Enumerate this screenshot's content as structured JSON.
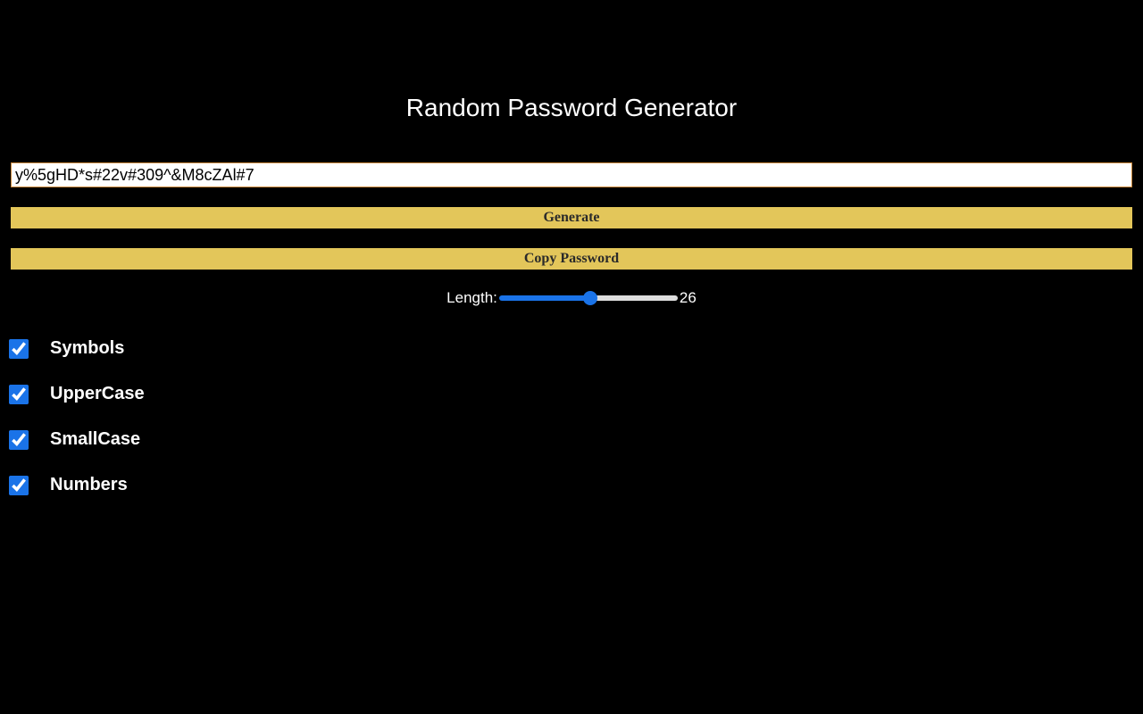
{
  "title": "Random Password Generator",
  "password_value": "y%5gHD*s#22v#309^&M8cZAl#7",
  "buttons": {
    "generate": "Generate",
    "copy": "Copy Password"
  },
  "length": {
    "label": "Length:",
    "value": "26",
    "min": "1",
    "max": "50"
  },
  "options": {
    "symbols": {
      "label": "Symbols",
      "checked": true
    },
    "uppercase": {
      "label": "UpperCase",
      "checked": true
    },
    "smallcase": {
      "label": "SmallCase",
      "checked": true
    },
    "numbers": {
      "label": "Numbers",
      "checked": true
    }
  }
}
